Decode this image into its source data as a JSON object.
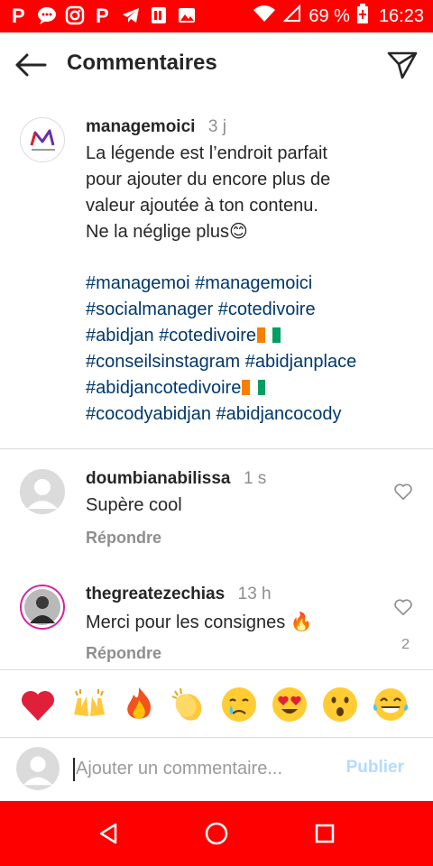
{
  "status_bar": {
    "battery": "69 %",
    "time": "16:23",
    "icons": [
      "pinterest-icon",
      "messages-icon",
      "instagram-icon",
      "pinterest-icon",
      "telegram-icon",
      "pdf-icon",
      "gallery-icon",
      "wifi-icon",
      "signal-icon",
      "battery-icon"
    ]
  },
  "header": {
    "title": "Commentaires",
    "back_icon": "arrow-left-icon",
    "send_icon": "paper-plane-icon"
  },
  "caption": {
    "username": "managemoici",
    "time": "3 j",
    "lines": [
      "La légende est l’endroit parfait",
      "pour ajouter du encore plus de",
      "valeur ajoutée à ton contenu.",
      "Ne la néglige plus😊"
    ],
    "hashtag_lines": [
      "#managemoi #managemoici",
      "#socialmanager #cotedivoire",
      "#abidjan #cotedivoire",
      "#conseilsinstagram #abidjanplace",
      "#abidjancotedivoire",
      "#cocodyabidjan #abidjancocody"
    ]
  },
  "comments": [
    {
      "username": "doumbianabilissa",
      "time": "1 s",
      "text": "Supère cool",
      "reply_label": "Répondre",
      "like_count": ""
    },
    {
      "username": "thegreatezechias",
      "time": "13 h",
      "text": "Merci pour les consignes 🔥",
      "reply_label": "Répondre",
      "like_count": "2"
    }
  ],
  "emoji_bar": [
    "❤️",
    "🙌",
    "🔥",
    "👏",
    "😢",
    "😍",
    "😮",
    "😂"
  ],
  "input": {
    "placeholder": "Ajouter un commentaire...",
    "value": "",
    "publish_label": "Publier"
  },
  "colors": {
    "status_bar": "#ff0000",
    "nav_bar": "#ff0000",
    "hashtag": "#00376b",
    "muted": "#8e8e8e",
    "publish_disabled": "#b3dbff"
  },
  "nav": {
    "icons": [
      "back-triangle-icon",
      "home-circle-icon",
      "recents-square-icon"
    ]
  }
}
